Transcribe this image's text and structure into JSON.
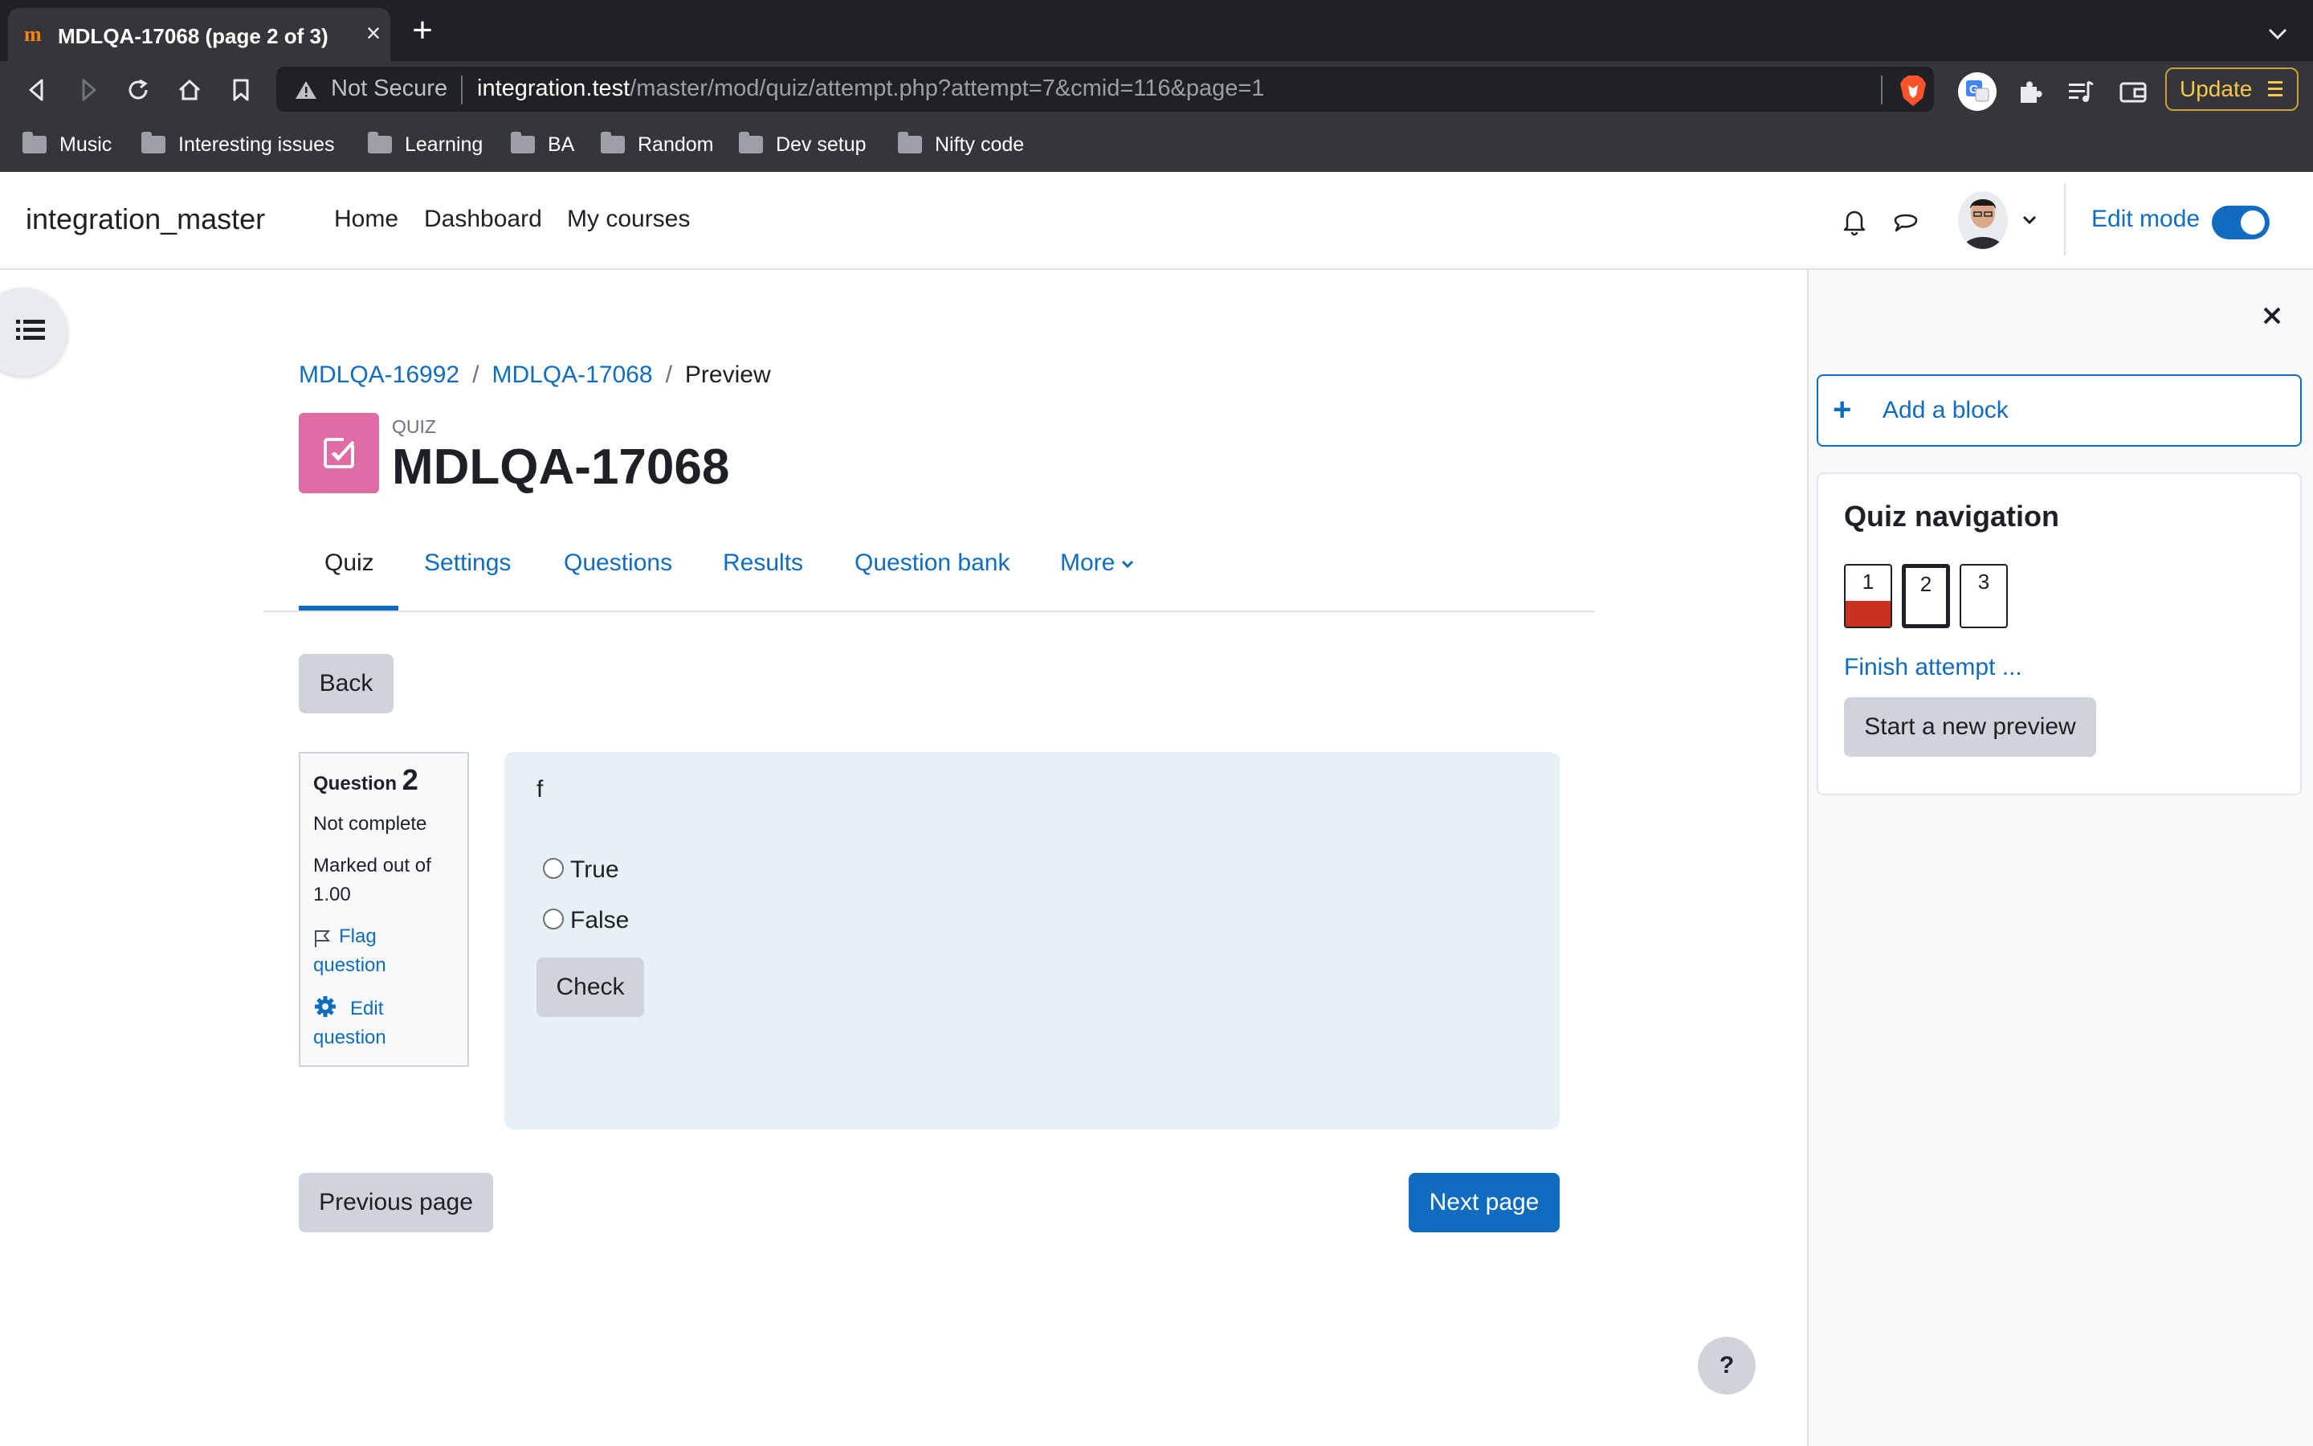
{
  "browser": {
    "tab_title": "MDLQA-17068 (page 2 of 3)",
    "omnibox": {
      "security_label": "Not Secure",
      "url_host": "integration.test",
      "url_path": "/master/mod/quiz/attempt.php?attempt=7&cmid=116&page=1"
    },
    "update_label": "Update",
    "bookmarks": [
      "Music",
      "Interesting issues",
      "Learning",
      "BA",
      "Random",
      "Dev setup",
      "Nifty code"
    ]
  },
  "navbar": {
    "site_name": "integration_master",
    "links": [
      "Home",
      "Dashboard",
      "My courses"
    ],
    "edit_mode_label": "Edit mode",
    "edit_mode_on": true
  },
  "breadcrumb": {
    "items": [
      "MDLQA-16992",
      "MDLQA-17068",
      "Preview"
    ],
    "separator": "/"
  },
  "header": {
    "module_label": "QUIZ",
    "title": "MDLQA-17068",
    "icon_color": "#e06ca5"
  },
  "secondary_nav": {
    "tabs": [
      "Quiz",
      "Settings",
      "Questions",
      "Results",
      "Question bank",
      "More"
    ],
    "active": "Quiz"
  },
  "back_label": "Back",
  "question": {
    "label": "Question",
    "number": "2",
    "state": "Not complete",
    "marked_line1": "Marked out of",
    "marked_line2": "1.00",
    "flag_line1": "Flag",
    "flag_line2": "question",
    "edit_line1": "Edit",
    "edit_line2": "question",
    "text": "f",
    "options": [
      "True",
      "False"
    ],
    "check_label": "Check"
  },
  "pagination": {
    "previous_label": "Previous page",
    "next_label": "Next page"
  },
  "help_label": "?",
  "drawer": {
    "add_block_label": "Add a block",
    "quiz_navigation": {
      "title": "Quiz navigation",
      "questions": [
        {
          "number": "1",
          "state": "incorrect"
        },
        {
          "number": "2",
          "state": "current"
        },
        {
          "number": "3",
          "state": "notyetanswered"
        }
      ],
      "finish_label": "Finish attempt ...",
      "new_preview_label": "Start a new preview"
    }
  },
  "colors": {
    "brand": "#0f6cbf",
    "incorrect": "#ca3120",
    "question_bg": "#e7f0f4"
  }
}
